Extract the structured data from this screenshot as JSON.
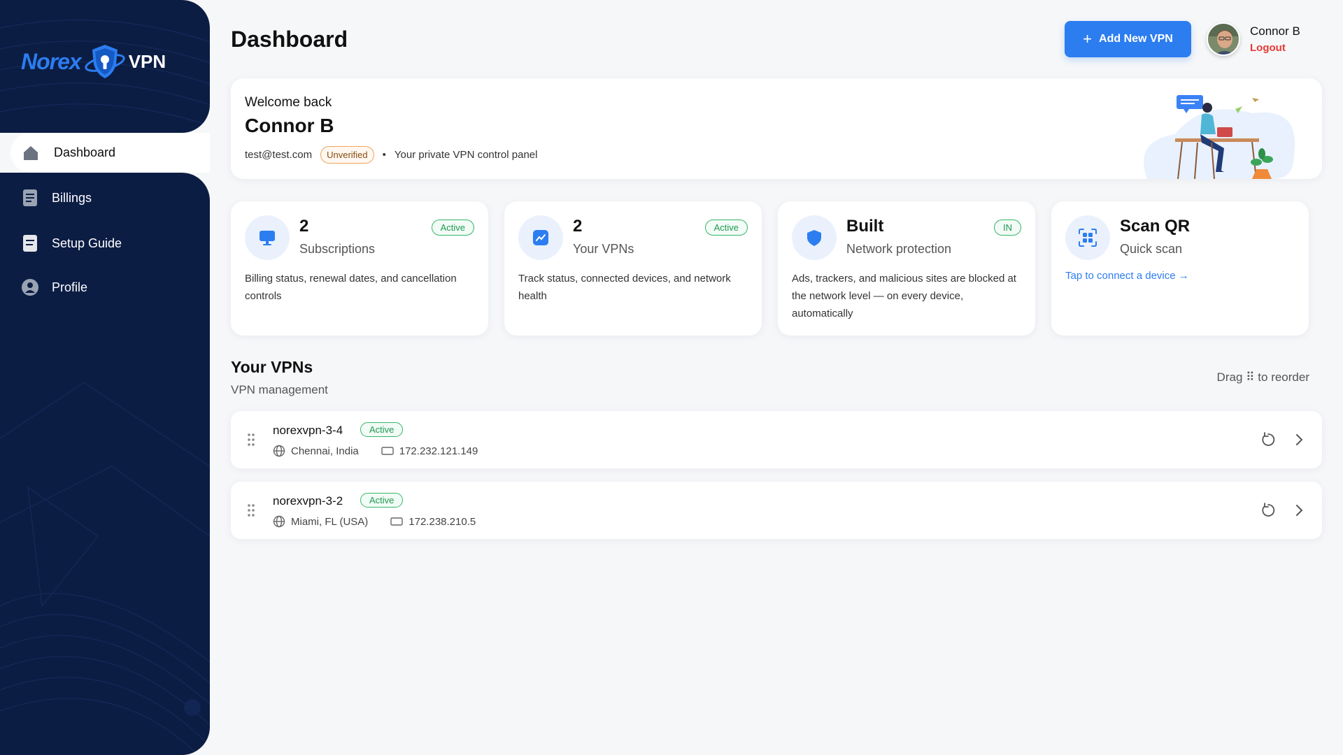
{
  "app": {
    "logo_text": "Norex",
    "logo_suffix": "VPN"
  },
  "sidebar": {
    "items": [
      {
        "label": "Dashboard",
        "icon": "home-icon",
        "active": true
      },
      {
        "label": "Billings",
        "icon": "billing-icon",
        "active": false
      },
      {
        "label": "Setup Guide",
        "icon": "guide-icon",
        "active": false
      },
      {
        "label": "Profile",
        "icon": "profile-icon",
        "active": false
      }
    ]
  },
  "header": {
    "title": "Dashboard",
    "add_button_label": "Add New VPN",
    "user_name": "Connor B",
    "logout_label": "Logout"
  },
  "welcome": {
    "greeting": "Welcome back",
    "name": "Connor B",
    "email": "test@test.com",
    "status_badge": "Unverified",
    "separator": "•",
    "tagline": "Your private VPN control panel"
  },
  "stats": [
    {
      "value": "2",
      "label": "Subscriptions",
      "badge": "Active",
      "description": "Billing status, renewal dates, and cancellation controls",
      "icon": "monitor-icon"
    },
    {
      "value": "2",
      "label": "Your VPNs",
      "badge": "Active",
      "description": "Track status, connected devices, and network health",
      "icon": "activity-icon"
    },
    {
      "value": "Built",
      "label": "Network protection",
      "badge": "IN",
      "description": "Ads, trackers, and malicious sites are blocked at the network level — on every device, automatically",
      "icon": "shield-icon"
    },
    {
      "value": "Scan QR",
      "label": "Quick scan",
      "link": "Tap to connect a device →",
      "icon": "qr-scan-icon"
    }
  ],
  "vpn_section": {
    "title": "Your VPNs",
    "subtitle": "VPN management",
    "drag_hint": "Drag ⠿ to reorder",
    "rows": [
      {
        "name": "norexvpn-3-4",
        "status": "Active",
        "location": "Chennai, India",
        "ip": "172.232.121.149"
      },
      {
        "name": "norexvpn-3-2",
        "status": "Active",
        "location": "Miami, FL (USA)",
        "ip": "172.238.210.5"
      }
    ]
  },
  "colors": {
    "sidebar_bg": "#0c1d44",
    "accent": "#2c7df0",
    "active_green": "#36b66a",
    "unverified_orange": "#f0a35a",
    "logout_red": "#e53935"
  }
}
